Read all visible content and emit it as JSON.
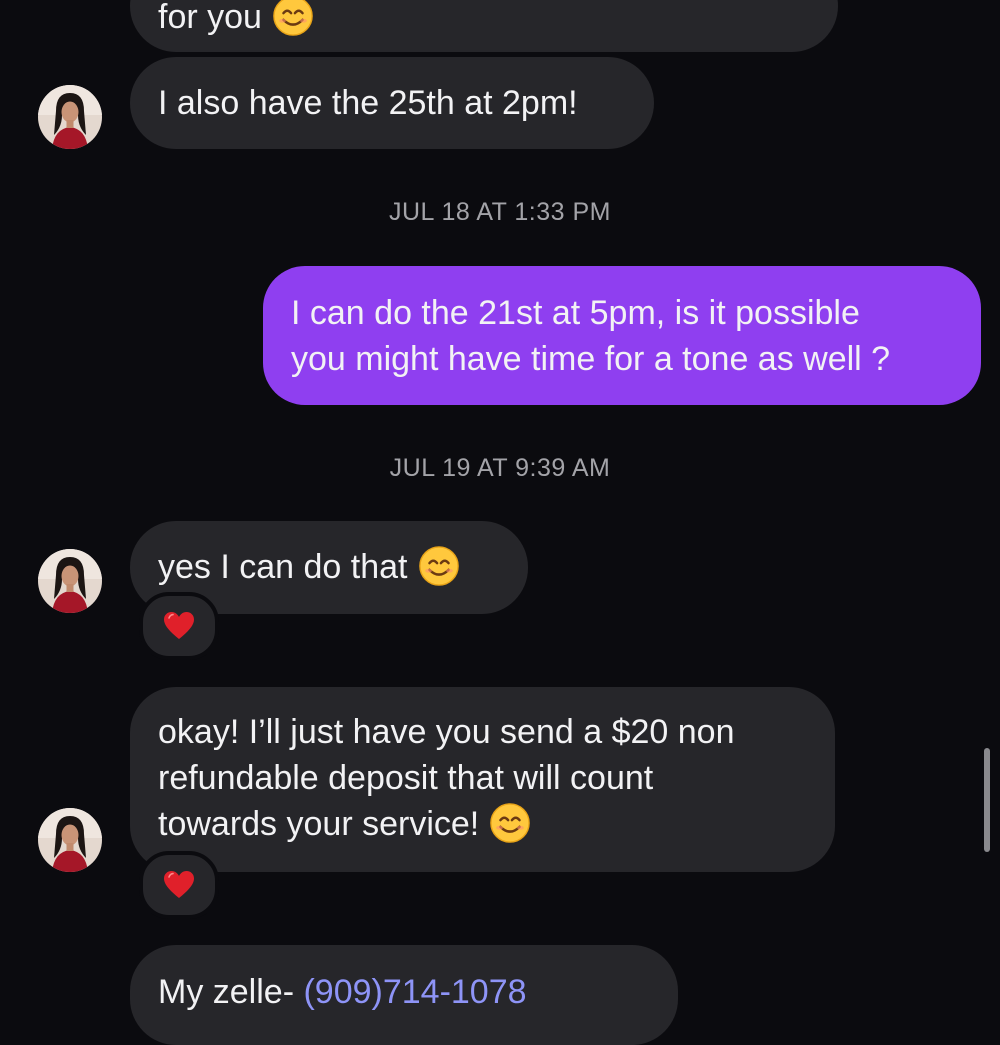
{
  "thread": {
    "message_top_fragment": "for you",
    "message_25th": "I also have the 25th at 2pm!",
    "timestamp_1": "JUL 18 AT 1:33 PM",
    "outgoing_lines": [
      "I can do the 21st at 5pm, is it possible",
      "you might have time for a tone as well ?"
    ],
    "timestamp_2": "JUL 19 AT 9:39 AM",
    "message_yes": "yes I can do that",
    "deposit_lines": [
      "okay! I’ll just have you send a $20 non",
      "refundable deposit that will count",
      "towards your service!"
    ],
    "zelle_prefix": "My zelle- ",
    "zelle_number": "(909)714-1078"
  },
  "icons": {
    "emoji": "smiling-face-icon",
    "reaction": "red-heart-icon",
    "avatar": "contact-avatar"
  },
  "colors": {
    "background": "#0b0b0f",
    "incoming_bubble": "#26262a",
    "outgoing_bubble": "#8f3ff0",
    "timestamp": "#a3a3a8",
    "link": "#8e94f7",
    "heart": "#e0202a"
  }
}
